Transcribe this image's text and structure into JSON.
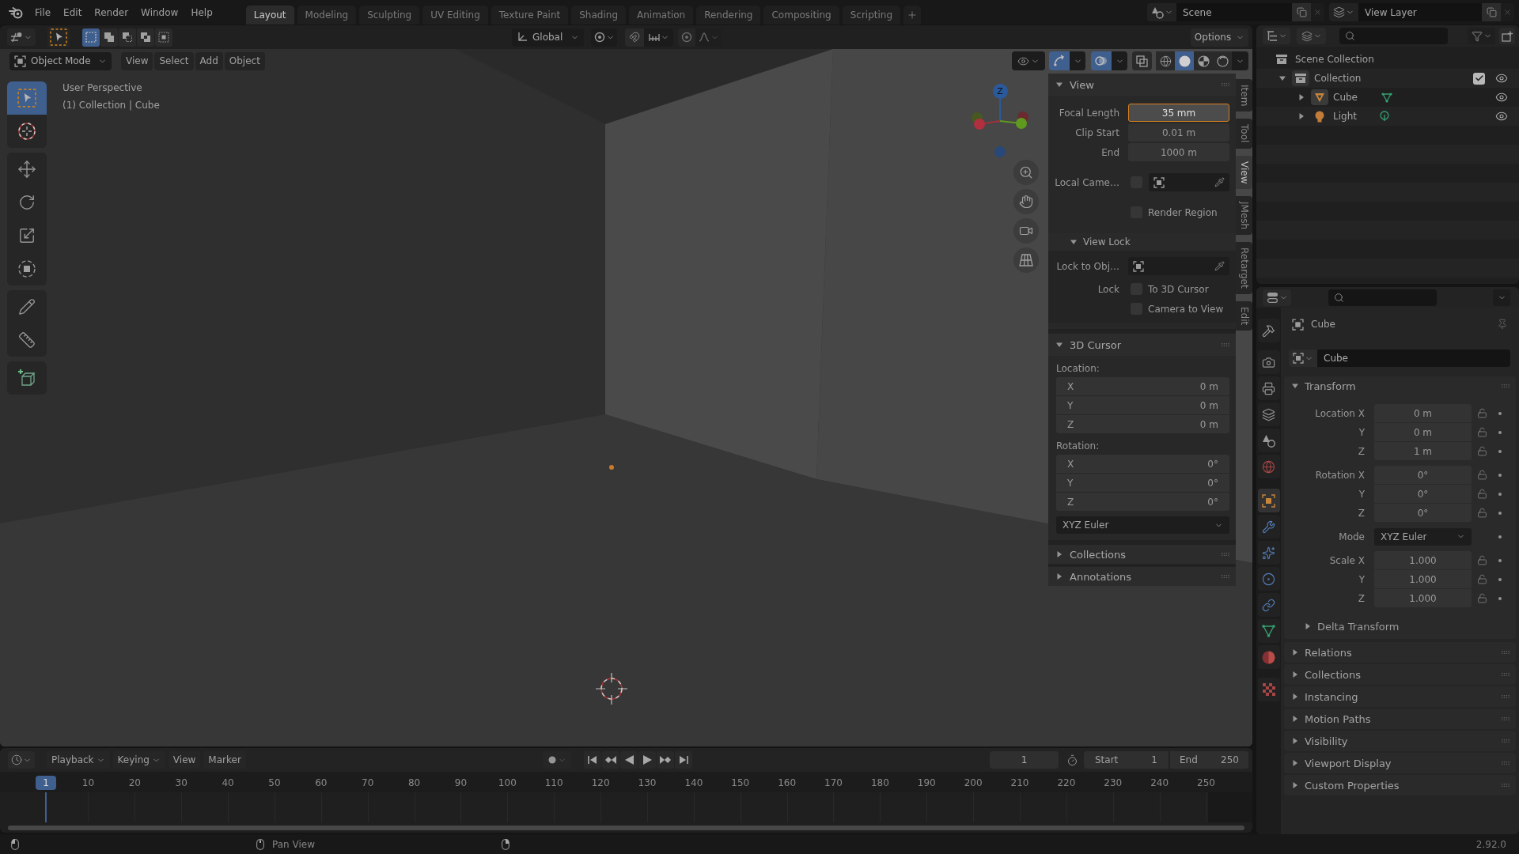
{
  "topbar": {
    "menus": [
      "File",
      "Edit",
      "Render",
      "Window",
      "Help"
    ],
    "workspaces": [
      {
        "label": "Layout",
        "selected": true
      },
      {
        "label": "Modeling",
        "selected": false
      },
      {
        "label": "Sculpting",
        "selected": false
      },
      {
        "label": "UV Editing",
        "selected": false
      },
      {
        "label": "Texture Paint",
        "selected": false
      },
      {
        "label": "Shading",
        "selected": false
      },
      {
        "label": "Animation",
        "selected": false
      },
      {
        "label": "Rendering",
        "selected": false
      },
      {
        "label": "Compositing",
        "selected": false
      },
      {
        "label": "Scripting",
        "selected": false
      }
    ],
    "scene": "Scene",
    "view_layer": "View Layer"
  },
  "tool_header": {
    "select_modes": [
      {
        "selected": true
      },
      {
        "selected": false
      },
      {
        "selected": false
      },
      {
        "selected": false
      },
      {
        "selected": false
      }
    ],
    "orientation": "Global",
    "snap": {
      "on": false
    },
    "proportional": {
      "on": false
    },
    "options": "Options"
  },
  "viewport": {
    "mode": "Object Mode",
    "menus": [
      "View",
      "Select",
      "Add",
      "Object"
    ],
    "gizmos": {
      "on": true
    },
    "overlays": {
      "on": true
    },
    "xray": {
      "on": false
    },
    "shading": [
      {
        "selected": false
      },
      {
        "selected": true
      },
      {
        "selected": false
      },
      {
        "selected": false
      }
    ],
    "info": [
      "User Perspective",
      "(1) Collection | Cube"
    ],
    "tools": [
      {
        "selected": true
      },
      {
        "selected": false
      },
      {
        "selected": false
      },
      {
        "selected": false
      },
      {
        "selected": false
      },
      {
        "selected": false
      },
      {
        "selected": false
      },
      {
        "selected": false
      },
      {
        "selected": false
      }
    ],
    "axis_label": "Z"
  },
  "sidebar": {
    "tabs": [
      {
        "label": "Item",
        "selected": false
      },
      {
        "label": "Tool",
        "selected": false
      },
      {
        "label": "View",
        "selected": true
      },
      {
        "label": "JMesh",
        "selected": false
      },
      {
        "label": "Retarget",
        "selected": false
      },
      {
        "label": "Edit",
        "selected": false
      }
    ],
    "panels": [
      {
        "title": "View",
        "expanded": true,
        "rows": [
          {
            "kind": "number",
            "label": "Focal Length",
            "value": "35 mm",
            "active": true
          },
          {
            "kind": "number",
            "label": "Clip Start",
            "value": "0.01 m",
            "active": false
          },
          {
            "kind": "number",
            "label": "End",
            "value": "1000 m",
            "active": false
          },
          {
            "kind": "picker",
            "label": "Local Came…",
            "checked": false
          },
          {
            "kind": "checkbox",
            "label": "Render Region",
            "checked": false
          },
          {
            "kind": "subpanel",
            "title": "View Lock",
            "expanded": true,
            "rows": [
              {
                "kind": "picker",
                "label": "Lock to Obj…"
              },
              {
                "kind": "checkbox",
                "prefix": "Lock",
                "label": "To 3D Cursor",
                "checked": false
              },
              {
                "kind": "checkbox",
                "label": "Camera to View",
                "checked": false
              }
            ]
          }
        ]
      },
      {
        "title": "3D Cursor",
        "expanded": true,
        "rows": [
          {
            "kind": "caption",
            "label": "Location:"
          },
          {
            "kind": "vector",
            "items": [
              {
                "axis": "X",
                "value": "0 m"
              },
              {
                "axis": "Y",
                "value": "0 m"
              },
              {
                "axis": "Z",
                "value": "0 m"
              }
            ]
          },
          {
            "kind": "caption",
            "label": "Rotation:"
          },
          {
            "kind": "vector",
            "items": [
              {
                "axis": "X",
                "value": "0°"
              },
              {
                "axis": "Y",
                "value": "0°"
              },
              {
                "axis": "Z",
                "value": "0°"
              }
            ]
          },
          {
            "kind": "dropdown",
            "value": "XYZ Euler"
          }
        ]
      },
      {
        "title": "Collections",
        "expanded": false
      },
      {
        "title": "Annotations",
        "expanded": false
      }
    ]
  },
  "outliner": {
    "tree": [
      {
        "label": "Scene Collection",
        "kind": "scene_collection",
        "children": [
          {
            "label": "Collection",
            "kind": "collection",
            "expanded": true,
            "checked": true,
            "visible": true,
            "children": [
              {
                "label": "Cube",
                "kind": "mesh",
                "expanded": false,
                "visible": true
              },
              {
                "label": "Light",
                "kind": "light",
                "expanded": false,
                "visible": true
              }
            ]
          }
        ]
      }
    ]
  },
  "properties": {
    "tabs": [
      {
        "selected": false
      },
      {
        "selected": false
      },
      {
        "selected": false
      },
      {
        "selected": false
      },
      {
        "selected": false
      },
      {
        "selected": false
      },
      {
        "selected": true
      },
      {
        "selected": false
      },
      {
        "selected": false
      },
      {
        "selected": false
      },
      {
        "selected": false
      },
      {
        "selected": false
      },
      {
        "selected": false
      },
      {
        "selected": false
      }
    ],
    "object": "Cube",
    "name": "Cube",
    "panels": [
      {
        "title": "Transform",
        "expanded": true,
        "groups": [
          {
            "kind": "number",
            "rows": [
              {
                "label": "Location X",
                "value": "0 m",
                "locked": false
              },
              {
                "label": "Y",
                "value": "0 m",
                "locked": false
              },
              {
                "label": "Z",
                "value": "1 m",
                "locked": false
              }
            ]
          },
          {
            "kind": "number",
            "rows": [
              {
                "label": "Rotation X",
                "value": "0°",
                "locked": false
              },
              {
                "label": "Y",
                "value": "0°",
                "locked": false
              },
              {
                "label": "Z",
                "value": "0°",
                "locked": false
              }
            ]
          },
          {
            "kind": "dropdown",
            "rows": [
              {
                "label": "Mode",
                "value": "XYZ Euler"
              }
            ]
          },
          {
            "kind": "number",
            "rows": [
              {
                "label": "Scale X",
                "value": "1.000",
                "locked": false
              },
              {
                "label": "Y",
                "value": "1.000",
                "locked": false
              },
              {
                "label": "Z",
                "value": "1.000",
                "locked": false
              }
            ]
          }
        ],
        "subpanels": [
          {
            "title": "Delta Transform",
            "expanded": false
          }
        ]
      },
      {
        "title": "Relations",
        "expanded": false
      },
      {
        "title": "Collections",
        "expanded": false
      },
      {
        "title": "Instancing",
        "expanded": false
      },
      {
        "title": "Motion Paths",
        "expanded": false
      },
      {
        "title": "Visibility",
        "expanded": false
      },
      {
        "title": "Viewport Display",
        "expanded": false
      },
      {
        "title": "Custom Properties",
        "expanded": false
      }
    ]
  },
  "timeline": {
    "menus": [
      {
        "label": "Playback",
        "dropdown": true
      },
      {
        "label": "Keying",
        "dropdown": true
      },
      {
        "label": "View",
        "dropdown": false
      },
      {
        "label": "Marker",
        "dropdown": false
      }
    ],
    "current_frame": "1",
    "start": {
      "label": "Start",
      "value": "1"
    },
    "end": {
      "label": "End",
      "value": "250"
    },
    "playhead": "1",
    "ruler": [
      "10",
      "20",
      "30",
      "40",
      "50",
      "60",
      "70",
      "80",
      "90",
      "100",
      "110",
      "120",
      "130",
      "140",
      "150",
      "160",
      "170",
      "180",
      "190",
      "200",
      "210",
      "220",
      "230",
      "240",
      "250"
    ]
  },
  "status_bar": {
    "hints": [
      {
        "kind": "left"
      },
      {
        "kind": "middle",
        "label": "Pan View"
      },
      {
        "kind": "right"
      }
    ],
    "version": "2.92.0"
  }
}
